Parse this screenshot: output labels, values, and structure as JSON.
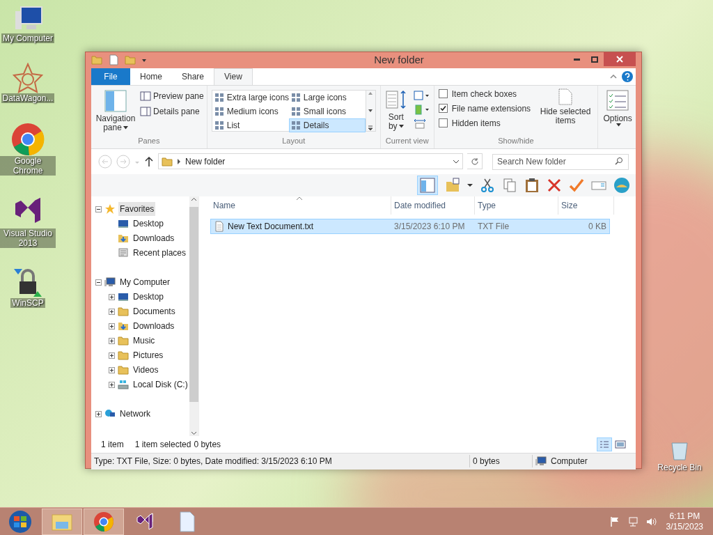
{
  "desktop_icons": [
    {
      "kind": "computer",
      "label": "My Computer"
    },
    {
      "kind": "star",
      "label": "DataWagon..."
    },
    {
      "kind": "chrome",
      "label": "Google Chrome"
    },
    {
      "kind": "vs",
      "label": "Visual Studio 2013"
    },
    {
      "kind": "lock",
      "label": "WinSCP"
    }
  ],
  "recycle_bin": {
    "label": "Recycle Bin"
  },
  "window": {
    "title": "New folder",
    "tabs": [
      {
        "label": "File",
        "kind": "file",
        "selected": false
      },
      {
        "label": "Home",
        "kind": "tab",
        "selected": false
      },
      {
        "label": "Share",
        "kind": "tab",
        "selected": false
      },
      {
        "label": "View",
        "kind": "tab",
        "selected": true
      }
    ],
    "ribbon": {
      "panes": {
        "label": "Panes",
        "navigation": "Navigation pane",
        "items": [
          "Preview pane",
          "Details pane"
        ]
      },
      "layout": {
        "label": "Layout",
        "options": [
          {
            "label": "Extra large icons",
            "selected": false
          },
          {
            "label": "Large icons",
            "selected": false
          },
          {
            "label": "Medium icons",
            "selected": false
          },
          {
            "label": "Small icons",
            "selected": false
          },
          {
            "label": "List",
            "selected": false
          },
          {
            "label": "Details",
            "selected": true
          }
        ]
      },
      "current_view": {
        "label": "Current view",
        "sort": "Sort by"
      },
      "show_hide": {
        "label": "Show/hide",
        "checkboxes": [
          {
            "label": "Item check boxes",
            "checked": false
          },
          {
            "label": "File name extensions",
            "checked": true
          },
          {
            "label": "Hidden items",
            "checked": false
          }
        ],
        "hide_selected": "Hide selected items"
      },
      "options": "Options"
    },
    "address": {
      "path": "New folder",
      "search_placeholder": "Search New folder"
    },
    "nav_tree": [
      {
        "label": "Favorites",
        "kind": "star",
        "expanded": true,
        "highlighted": true,
        "children": [
          {
            "label": "Desktop",
            "kind": "desktop"
          },
          {
            "label": "Downloads",
            "kind": "downloads"
          },
          {
            "label": "Recent places",
            "kind": "recent"
          }
        ]
      },
      {
        "label": "My Computer",
        "kind": "computer",
        "expanded": true,
        "highlighted": false,
        "children": [
          {
            "label": "Desktop",
            "kind": "desktop",
            "expanded": false
          },
          {
            "label": "Documents",
            "kind": "folder",
            "expanded": false
          },
          {
            "label": "Downloads",
            "kind": "downloads",
            "expanded": false
          },
          {
            "label": "Music",
            "kind": "folder",
            "expanded": false
          },
          {
            "label": "Pictures",
            "kind": "folder",
            "expanded": false
          },
          {
            "label": "Videos",
            "kind": "folder",
            "expanded": false
          },
          {
            "label": "Local Disk (C:)",
            "kind": "disk",
            "expanded": false
          }
        ]
      },
      {
        "label": "Network",
        "kind": "network",
        "expanded": false,
        "highlighted": false
      }
    ],
    "columns": [
      "Name",
      "Date modified",
      "Type",
      "Size"
    ],
    "rows": [
      {
        "name": "New Text Document.txt",
        "date": "3/15/2023 6:10 PM",
        "type": "TXT File",
        "size": "0 KB",
        "selected": true
      }
    ],
    "status": {
      "count": "1 item",
      "selected": "1 item selected",
      "size": "0 bytes"
    },
    "details_bar": {
      "info": "Type: TXT File, Size: 0 bytes, Date modified: 3/15/2023 6:10 PM",
      "size": "0 bytes",
      "location": "Computer"
    }
  },
  "taskbar": {
    "apps": [
      {
        "kind": "explorer",
        "active": true
      },
      {
        "kind": "chrome",
        "active": true
      },
      {
        "kind": "vs",
        "active": false
      },
      {
        "kind": "document",
        "active": false
      }
    ],
    "time": "6:11 PM",
    "date": "3/15/2023"
  }
}
